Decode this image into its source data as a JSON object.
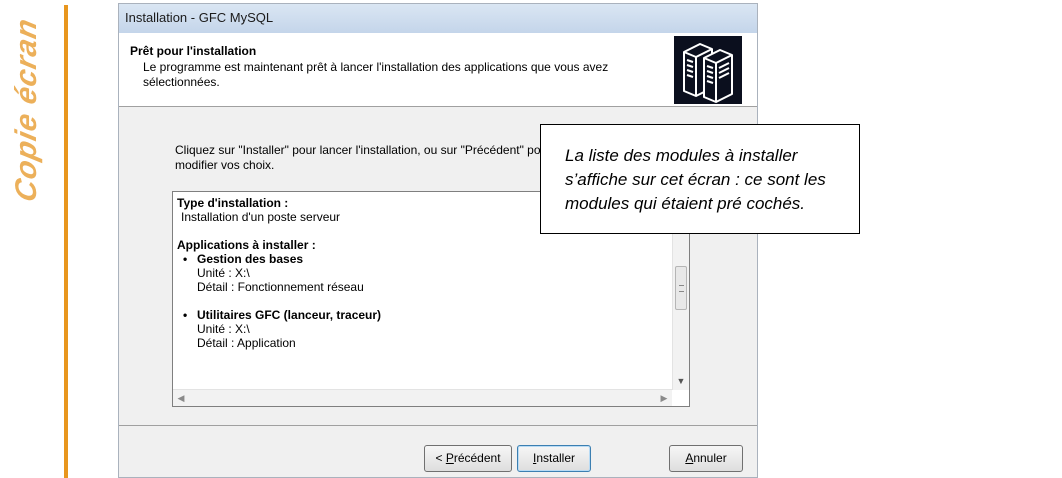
{
  "side_label": "Copie écran",
  "window": {
    "title": "Installation - GFC MySQL"
  },
  "header": {
    "title": "Prêt pour l'installation",
    "description": "Le programme est maintenant prêt à lancer l'installation des applications que vous avez sélectionnées."
  },
  "instructions": "Cliquez sur \"Installer\" pour lancer l'installation, ou sur \"Précédent\" pour revoir ou modifier vos choix.",
  "summary": {
    "install_type_title": "Type d'installation :",
    "install_type_value": "Installation d'un poste serveur",
    "apps_title": "Applications à installer :",
    "apps": [
      {
        "name": "Gestion des bases",
        "unit": "Unité : X:\\",
        "detail": "Détail : Fonctionnement réseau"
      },
      {
        "name": "Utilitaires GFC (lanceur, traceur)",
        "unit": "Unité : X:\\",
        "detail": "Détail : Application"
      }
    ]
  },
  "buttons": {
    "prev": "Précédent",
    "prev_prefix": "< ",
    "prev_accel": "P",
    "install": "Installer",
    "install_accel": "I",
    "cancel": "Annuler",
    "cancel_accel": "A"
  },
  "callout": {
    "text": "La liste des modules à installer s’affiche sur cet écran : ce sont les modules qui étaient pré cochés."
  },
  "icons": {
    "installer": "computers-icon"
  }
}
